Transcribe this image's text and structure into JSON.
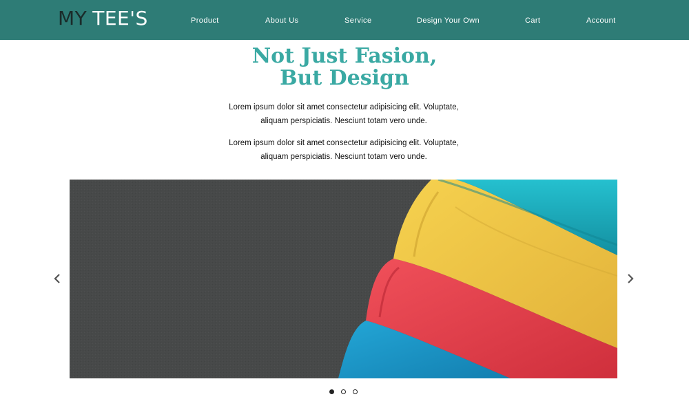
{
  "header": {
    "logo_part1": "MY",
    "logo_part2": "TEE'S",
    "nav": [
      "Product",
      "About Us",
      "Service",
      "Design Your Own",
      "Cart",
      "Account"
    ]
  },
  "hero": {
    "title_line1": "Not Just Fasion,",
    "title_line2": "But Design",
    "paragraphs": [
      [
        "Lorem ipsum dolor sit amet consectetur adipisicing elit. Voluptate,",
        "aliquam perspiciatis. Nesciunt totam vero unde."
      ],
      [
        "Lorem ipsum dolor sit amet consectetur adipisicing elit. Voluptate,",
        "aliquam perspiciatis. Nesciunt totam vero unde."
      ]
    ]
  },
  "carousel": {
    "slide_count": 3,
    "active_slide": 1,
    "prev_icon": "chevron-left-icon",
    "next_icon": "chevron-right-icon"
  },
  "colors": {
    "header_bg": "#2e7c76",
    "title_color": "#3aa9a3",
    "tee_teal": "#1fb4c4",
    "tee_yellow": "#f2c843",
    "tee_red": "#e8434c",
    "tee_blue": "#1d97c9",
    "fabric_gray": "#4a4b4c"
  }
}
